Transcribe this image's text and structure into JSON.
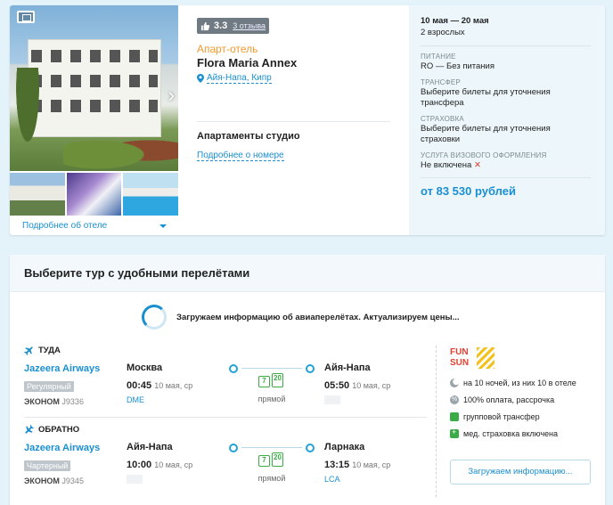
{
  "hotel": {
    "rating_score": "3.3",
    "rating_reviews": "3 отзыва",
    "type": "Апарт-отель",
    "name": "Flora Maria Annex",
    "location": "Айя-Напа, Кипр",
    "room_name": "Апартаменты студио",
    "room_link": "Подробнее о номере",
    "gallery_link": "Подробнее об отеле"
  },
  "summary": {
    "dates": "10 мая — 20 мая",
    "pax": "2 взрослых",
    "meal_label": "ПИТАНИЕ",
    "meal_value": "RO — Без питания",
    "transfer_label": "ТРАНСФЕР",
    "transfer_value": "Выберите билеты для уточнения трансфера",
    "insurance_label": "СТРАХОВКА",
    "insurance_value": "Выберите билеты для уточнения страховки",
    "visa_label": "УСЛУГА ВИЗОВОГО ОФОРМЛЕНИЯ",
    "visa_value": "Не включена",
    "visa_mark": "✕",
    "price": "от 83 530 рублей"
  },
  "flights": {
    "header": "Выберите тур с удобными перелётами",
    "loading": "Загружаем информацию об авиаперелётах. Актуализируем цены...",
    "outbound": {
      "title": "ТУДА",
      "airline": "Jazeera Airways",
      "type": "Регулярный",
      "cabin": "ЭКОНОМ",
      "flight_no": "J9336",
      "from_city": "Москва",
      "from_time": "00:45",
      "from_date": "10 мая, ср",
      "from_code": "DME",
      "to_city": "Айя-Напа",
      "to_time": "05:50",
      "to_date": "10 мая, ср",
      "to_code": "",
      "route": "прямой",
      "bag1": "7",
      "bag2": "20"
    },
    "return": {
      "title": "ОБРАТНО",
      "airline": "Jazeera Airways",
      "type": "Чартерный",
      "cabin": "ЭКОНОМ",
      "flight_no": "J9345",
      "from_city": "Айя-Напа",
      "from_time": "10:00",
      "from_date": "10 мая, ср",
      "from_code": "",
      "to_city": "Ларнака",
      "to_time": "13:15",
      "to_date": "10 мая, ср",
      "to_code": "LCA",
      "route": "прямой",
      "bag1": "7",
      "bag2": "20"
    }
  },
  "provider": {
    "logo_line1": "FUN",
    "logo_line2": "SUN",
    "nights": "на 10 ночей, из них 10 в отеле",
    "payment": "100% оплата, рассрочка",
    "transfer": "групповой трансфер",
    "insurance": "мед. страховка включена",
    "button": "Загружаем информацию..."
  },
  "colors": {
    "accent": "#1a8fd0",
    "orange": "#f29a2e",
    "green": "#3bab45",
    "red": "#e3412f",
    "background": "#e4f3f9"
  }
}
